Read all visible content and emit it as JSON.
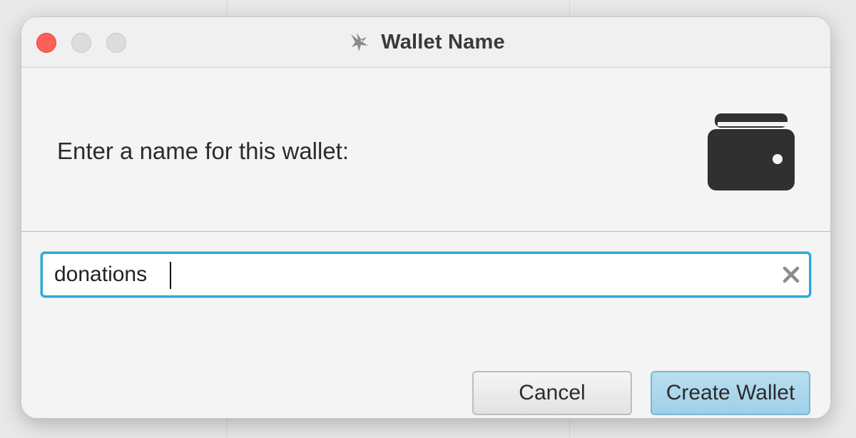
{
  "window": {
    "title": "Wallet Name",
    "title_icon": "sparrow-bird-icon"
  },
  "header": {
    "prompt": "Enter a name for this wallet:",
    "icon": "wallet-icon"
  },
  "form": {
    "name_value": "donations",
    "clear_icon": "clear-x-icon"
  },
  "buttons": {
    "cancel_label": "Cancel",
    "create_label": "Create Wallet"
  },
  "colors": {
    "focus_border": "#2aa9d8",
    "default_button": "#a6d4ea",
    "close_button": "#fe5f57"
  }
}
